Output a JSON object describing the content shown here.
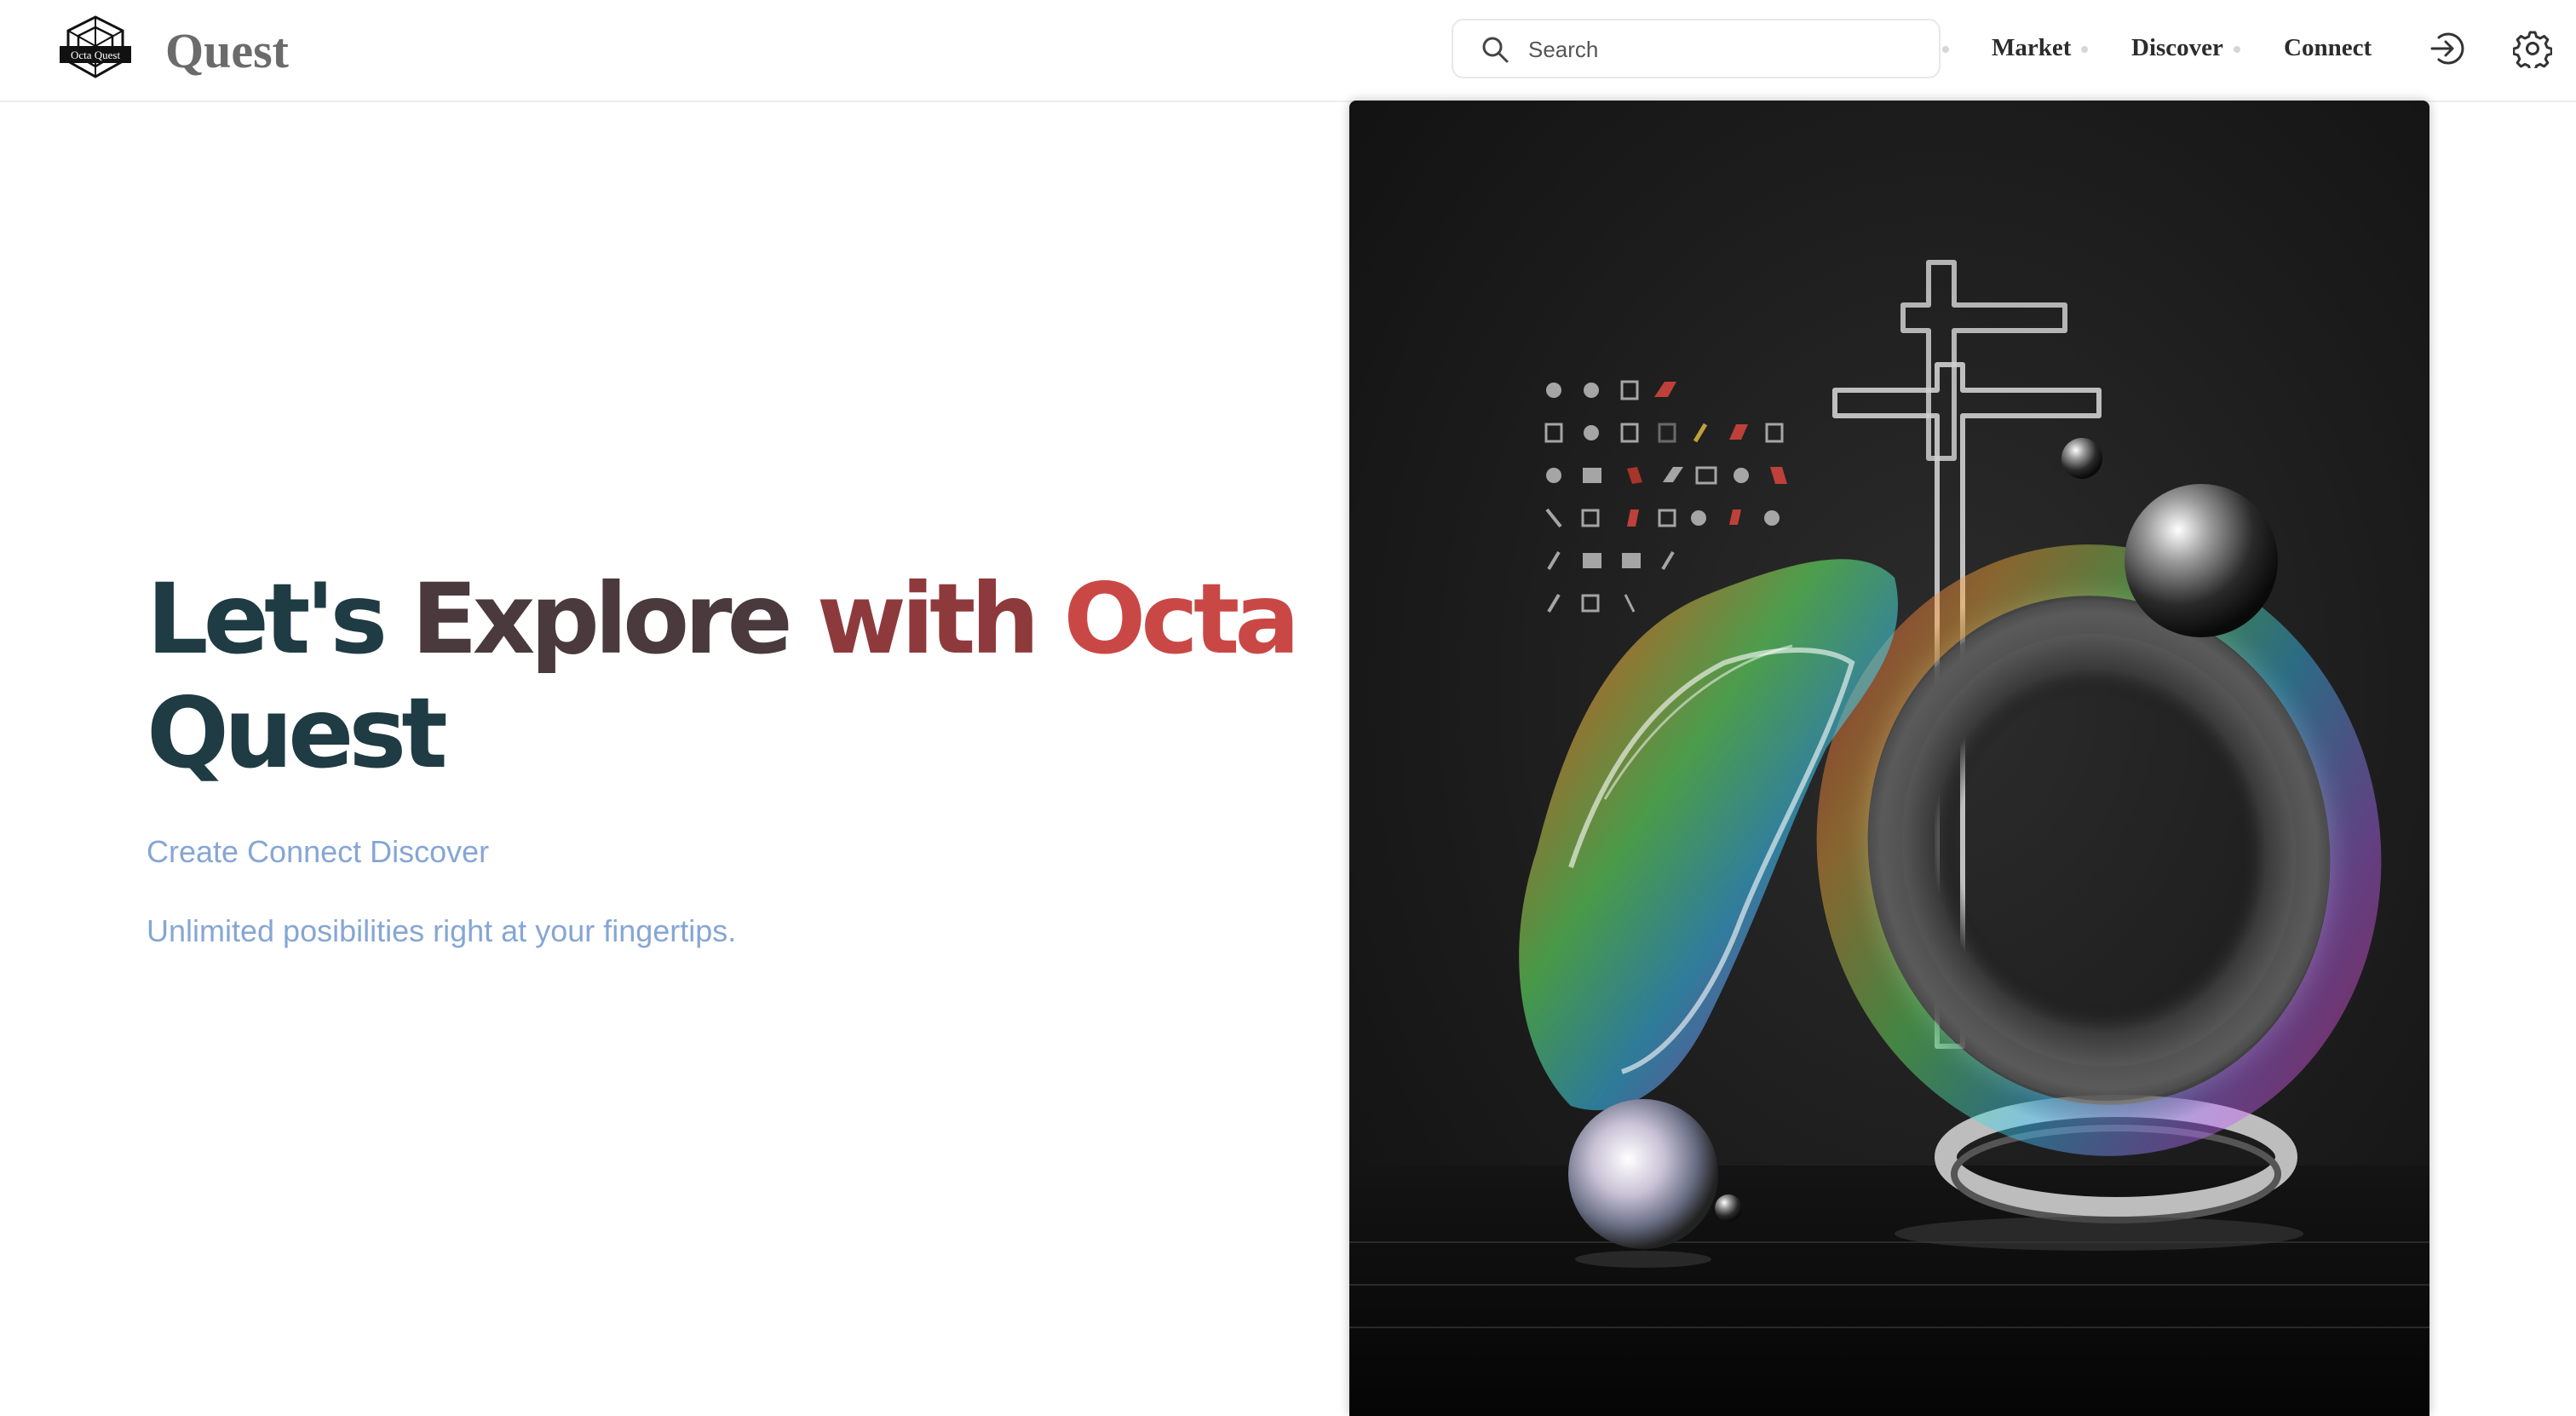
{
  "header": {
    "logo_text": "Octa Quest",
    "brand": "Quest",
    "search": {
      "placeholder": "Search",
      "icon": "search-icon"
    },
    "nav": [
      {
        "label": "Market"
      },
      {
        "label": "Discover"
      },
      {
        "label": "Connect"
      }
    ],
    "icons": [
      "login-icon",
      "gear-icon"
    ]
  },
  "hero": {
    "title_words": [
      "Let's",
      "Explore",
      "with",
      "Octa",
      "Quest"
    ],
    "title_colors": [
      "#1f3b44",
      "#4a3a3d",
      "#8e3a3c",
      "#c94846",
      "#1f3b44"
    ],
    "tagline": "Create Connect Discover",
    "subtitle": "Unlimited posibilities right at your fingertips."
  },
  "artwork": {
    "description_icon": "abstract-3d-artwork"
  }
}
